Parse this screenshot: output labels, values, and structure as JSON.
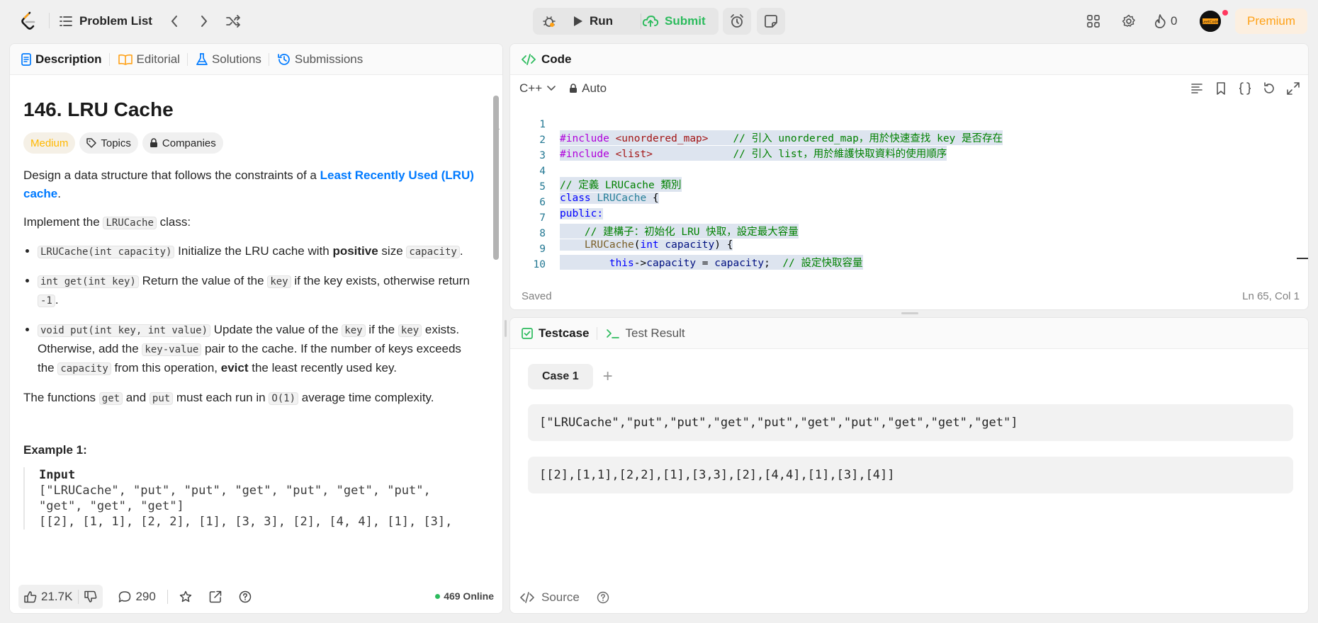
{
  "topbar": {
    "problem_list": "Problem List",
    "run": "Run",
    "submit": "Submit",
    "streak_count": "0",
    "premium": "Premium",
    "avatar_text": "LeetCode"
  },
  "left": {
    "tabs": [
      {
        "label": "Description"
      },
      {
        "label": "Editorial"
      },
      {
        "label": "Solutions"
      },
      {
        "label": "Submissions"
      }
    ],
    "title": "146. LRU Cache",
    "difficulty": "Medium",
    "topics": "Topics",
    "companies": "Companies",
    "p1_a": "Design a data structure that follows the constraints of a ",
    "p1_link": "Least Recently Used (LRU) cache",
    "p1_b": ".",
    "p2_a": "Implement the ",
    "p2_code": "LRUCache",
    "p2_b": " class:",
    "b1_code1": "LRUCache(int capacity)",
    "b1_text1": " Initialize the LRU cache with ",
    "b1_bold": "positive",
    "b1_text2": " size ",
    "b1_code2": "capacity",
    "b1_text3": ".",
    "b2_code1": "int get(int key)",
    "b2_text1": " Return the value of the ",
    "b2_code2": "key",
    "b2_text2": " if the key exists, otherwise return ",
    "b2_code3": "-1",
    "b2_text3": ".",
    "b3_code1": "void put(int key, int value)",
    "b3_text1": " Update the value of the ",
    "b3_code2": "key",
    "b3_text2": " if the ",
    "b3_code3": "key",
    "b3_text3": " exists. Otherwise, add the ",
    "b3_code4": "key-value",
    "b3_text4": " pair to the cache. If the number of keys exceeds the ",
    "b3_code5": "capacity",
    "b3_text5": " from this operation, ",
    "b3_bold": "evict",
    "b3_text6": " the least recently used key.",
    "p3_a": "The functions ",
    "p3_code1": "get",
    "p3_b": " and ",
    "p3_code2": "put",
    "p3_c": " must each run in ",
    "p3_code3": "O(1)",
    "p3_d": " average time complexity.",
    "example_title": "Example 1:",
    "input_label": "Input",
    "input_line1": "[\"LRUCache\", \"put\", \"put\", \"get\", \"put\", \"get\", \"put\",",
    "input_line2": "\"get\", \"get\", \"get\"]",
    "input_line3": "[[2], [1, 1], [2, 2], [1], [3, 3], [2], [4, 4], [1], [3],",
    "likes": "21.7K",
    "comments": "290",
    "online": "469 Online"
  },
  "code": {
    "header": "Code",
    "language": "C++",
    "mode": "Auto",
    "status": "Saved",
    "cursor": "Ln 65, Col 1",
    "lines": [
      {
        "n": "1"
      },
      {
        "n": "2"
      },
      {
        "n": "3"
      },
      {
        "n": "4"
      },
      {
        "n": "5"
      },
      {
        "n": "6"
      },
      {
        "n": "7"
      },
      {
        "n": "8"
      },
      {
        "n": "9"
      },
      {
        "n": "10"
      }
    ],
    "l1_a": "#include",
    "l1_b": " <unordered_map>",
    "l1_c": "    // 引入 unordered_map，用於快速查找 key 是否存在",
    "l2_a": "#include",
    "l2_b": " <list>",
    "l2_c": "             // 引入 list，用於維護快取資料的使用順序",
    "l4": "// 定義 LRUCache 類別",
    "l5_a": "class",
    "l5_b": " LRUCache",
    "l5_c": " {",
    "l6": "public:",
    "l7": "    // 建構子：初始化 LRU 快取，設定最大容量",
    "l8_a": "    LRUCache",
    "l8_b": "(",
    "l8_c": "int",
    "l8_d": " capacity",
    "l8_e": ") {",
    "l9_a": "        this",
    "l9_b": "->",
    "l9_c": "capacity",
    "l9_d": " = ",
    "l9_e": "capacity",
    "l9_f": ";  ",
    "l9_g": "// 設定快取容量",
    "l10": "    }"
  },
  "test": {
    "tab_testcase": "Testcase",
    "tab_result": "Test Result",
    "case_label": "Case 1",
    "add": "+",
    "input1": "[\"LRUCache\",\"put\",\"put\",\"get\",\"put\",\"get\",\"put\",\"get\",\"get\",\"get\"]",
    "input2": "[[2],[1,1],[2,2],[1],[3,3],[2],[4,4],[1],[3],[4]]",
    "source": "Source"
  }
}
